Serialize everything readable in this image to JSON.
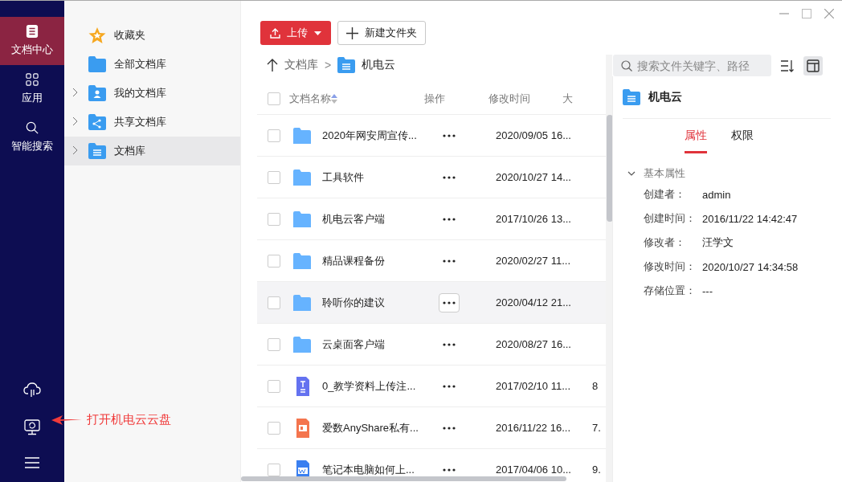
{
  "rail": {
    "items": [
      {
        "label": "文档中心",
        "kind": "document",
        "selected": true
      },
      {
        "label": "应用",
        "kind": "apps",
        "selected": false
      },
      {
        "label": "智能搜索",
        "kind": "search",
        "selected": false
      }
    ]
  },
  "annotation": {
    "text": "打开机电云云盘"
  },
  "nav_tree": {
    "items": [
      {
        "label": "收藏夹",
        "kind": "star",
        "selected": false
      },
      {
        "label": "全部文档库",
        "kind": "folder",
        "selected": false
      },
      {
        "label": "我的文档库",
        "kind": "user",
        "expanded": false,
        "selected": false
      },
      {
        "label": "共享文档库",
        "kind": "share",
        "expanded": false,
        "selected": false
      },
      {
        "label": "文档库",
        "kind": "list",
        "expanded": false,
        "selected": true
      }
    ]
  },
  "toolbar": {
    "upload": "上传",
    "new_folder": "新建文件夹"
  },
  "breadcrumb": {
    "parent": "文档库",
    "separator": ">",
    "current": "机电云"
  },
  "search": {
    "placeholder": "搜索文件关键字、路径"
  },
  "table": {
    "select_all": {
      "checked": false
    },
    "columns": [
      "文档名称",
      "操作",
      "修改时间",
      "大"
    ],
    "rows": [
      {
        "kind": "folder",
        "name": "2020年网安周宣传...",
        "modified": "2020/09/05 16...",
        "hovered": false,
        "checked": false
      },
      {
        "kind": "folder",
        "name": "工具软件",
        "modified": "2020/10/27 14...",
        "hovered": false,
        "checked": false
      },
      {
        "kind": "folder",
        "name": "机电云客户端",
        "modified": "2017/10/26 13...",
        "hovered": false,
        "checked": false
      },
      {
        "kind": "folder",
        "name": "精品课程备份",
        "modified": "2020/02/27 11...",
        "hovered": false,
        "checked": false
      },
      {
        "kind": "folder",
        "name": "聆听你的建议",
        "modified": "2020/04/12 21...",
        "hovered": true,
        "checked": false
      },
      {
        "kind": "folder",
        "name": "云桌面客户端",
        "modified": "2020/08/27 16...",
        "hovered": false,
        "checked": false
      },
      {
        "kind": "text",
        "name": "0_教学资料上传注...",
        "modified": "2017/02/10 11...",
        "size": "8",
        "hovered": false,
        "checked": false
      },
      {
        "kind": "slides",
        "name": "爱数AnyShare私有...",
        "modified": "2016/11/22 16...",
        "size": "7.",
        "hovered": false,
        "checked": false
      },
      {
        "kind": "word",
        "name": "笔记本电脑如何上...",
        "modified": "2017/04/06 10...",
        "size": "9.",
        "hovered": false,
        "checked": false
      }
    ]
  },
  "detail": {
    "title": "机电云",
    "tabs": [
      {
        "label": "属性",
        "selected": true
      },
      {
        "label": "权限",
        "selected": false
      }
    ],
    "section": {
      "label": "基本属性",
      "expanded": true
    },
    "properties": [
      {
        "label": "创建者：",
        "value": "admin"
      },
      {
        "label": "创建时间：",
        "value": "2016/11/22 14:42:47"
      },
      {
        "label": "修改者：",
        "value": "汪学文"
      },
      {
        "label": "修改时间：",
        "value": "2020/10/27 14:34:58"
      },
      {
        "label": "存储位置：",
        "value": "---"
      }
    ]
  }
}
